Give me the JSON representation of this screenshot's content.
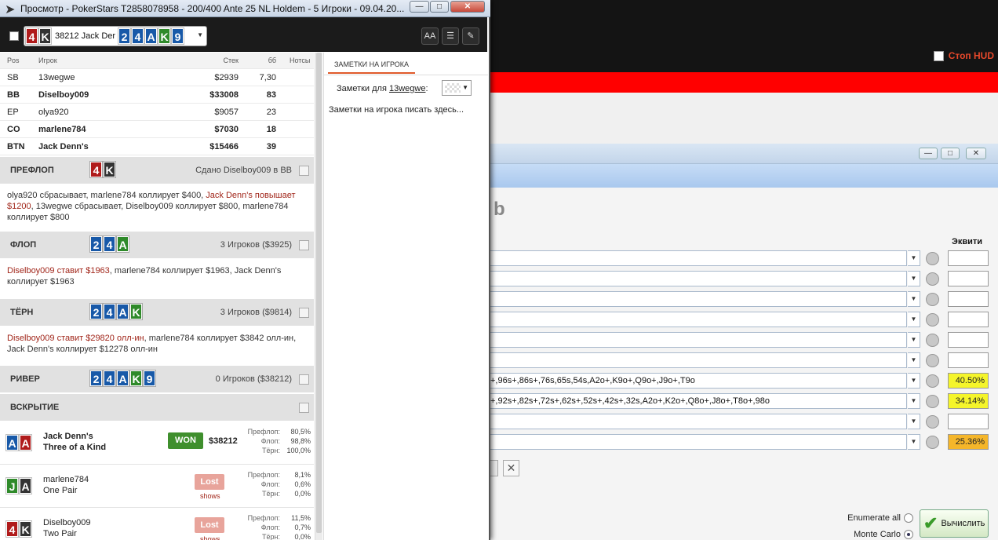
{
  "window": {
    "title": "Просмотр - PokerStars T2858078958 - 200/400 Ante 25 NL Holdem - 5 Игроки - 09.04.20...",
    "min_label": "—",
    "max_label": "□",
    "close_label": "✕"
  },
  "toolbar": {
    "hand_selector": {
      "hero_cards": [
        {
          "rank": "4",
          "color": "red"
        },
        {
          "rank": "K",
          "color": "blk"
        }
      ],
      "label": "38212 Jack Der",
      "board": [
        {
          "rank": "2",
          "color": "blue"
        },
        {
          "rank": "4",
          "color": "blue"
        },
        {
          "rank": "A",
          "color": "blue"
        },
        {
          "rank": "K",
          "color": "grn"
        },
        {
          "rank": "9",
          "color": "blue"
        }
      ]
    },
    "font_button": "AA",
    "list_button": "☰",
    "edit_button": "✎"
  },
  "players_table": {
    "headers": {
      "pos": "Pos",
      "player": "Игрок",
      "stack": "Стек",
      "bb": "бб",
      "notes": "Нотсы"
    },
    "rows": [
      {
        "pos": "SB",
        "name": "13wegwe",
        "stack": "$2939",
        "bb": "7,30",
        "bold": false
      },
      {
        "pos": "BB",
        "name": "Diselboy009",
        "stack": "$33008",
        "bb": "83",
        "bold": true
      },
      {
        "pos": "EP",
        "name": "olya920",
        "stack": "$9057",
        "bb": "23",
        "bold": false
      },
      {
        "pos": "CO",
        "name": "marlene784",
        "stack": "$7030",
        "bb": "18",
        "bold": true
      },
      {
        "pos": "BTN",
        "name": "Jack Denn's",
        "stack": "$15466",
        "bb": "39",
        "bold": true
      }
    ]
  },
  "streets": {
    "preflop": {
      "name": "ПРЕФЛОП",
      "cards": [
        {
          "rank": "4",
          "color": "red"
        },
        {
          "rank": "K",
          "color": "blk"
        }
      ],
      "info": "Сдано Diselboy009 в BB",
      "actions_a": "olya920 сбрасывает, marlene784 коллирует $400, ",
      "actions_b": "Jack Denn's повышает $1200",
      "actions_c": ", 13wegwe сбрасывает, Diselboy009 коллирует $800, marlene784 коллирует $800"
    },
    "flop": {
      "name": "ФЛОП",
      "cards": [
        {
          "rank": "2",
          "color": "blue"
        },
        {
          "rank": "4",
          "color": "blue"
        },
        {
          "rank": "A",
          "color": "grn"
        }
      ],
      "info": "3 Игроков ($3925)",
      "actions_a": "Diselboy009 ставит $1963",
      "actions_b": ", marlene784 коллирует $1963, Jack Denn's коллирует $1963"
    },
    "turn": {
      "name": "ТЁРН",
      "cards": [
        {
          "rank": "2",
          "color": "blue"
        },
        {
          "rank": "4",
          "color": "blue"
        },
        {
          "rank": "A",
          "color": "blue"
        },
        {
          "rank": "K",
          "color": "grn"
        }
      ],
      "info": "3 Игроков ($9814)",
      "actions_a": "Diselboy009 ставит $29820 олл-ин",
      "actions_b": ", marlene784 коллирует $3842 олл-ин, Jack Denn's коллирует $12278 олл-ин"
    },
    "river": {
      "name": "РИВЕР",
      "cards": [
        {
          "rank": "2",
          "color": "blue"
        },
        {
          "rank": "4",
          "color": "blue"
        },
        {
          "rank": "A",
          "color": "blue"
        },
        {
          "rank": "K",
          "color": "grn"
        },
        {
          "rank": "9",
          "color": "blue"
        }
      ],
      "info": "0 Игроков ($38212)"
    },
    "showdown": {
      "name": "ВСКРЫТИЕ"
    }
  },
  "results": [
    {
      "cards": [
        {
          "rank": "A",
          "color": "blue"
        },
        {
          "rank": "A",
          "color": "red"
        }
      ],
      "name": "Jack Denn's",
      "hand": "Three of a Kind",
      "bold": true,
      "status": "WON",
      "amount": "$38212",
      "eq_labels": [
        "Префлоп:",
        "Флоп:",
        "Тёрн:"
      ],
      "eq_values": [
        "80,5%",
        "98,8%",
        "100,0%"
      ]
    },
    {
      "cards": [
        {
          "rank": "J",
          "color": "grn"
        },
        {
          "rank": "A",
          "color": "blk"
        }
      ],
      "name": "marlene784",
      "hand": "One Pair",
      "bold": false,
      "status": "Lost",
      "shows": "shows",
      "eq_labels": [
        "Префлоп:",
        "Флоп:",
        "Тёрн:"
      ],
      "eq_values": [
        "8,1%",
        "0,6%",
        "0,0%"
      ]
    },
    {
      "cards": [
        {
          "rank": "4",
          "color": "red"
        },
        {
          "rank": "K",
          "color": "blk"
        }
      ],
      "name": "Diselboy009",
      "hand": "Two Pair",
      "bold": false,
      "status": "Lost",
      "shows": "shows",
      "eq_labels": [
        "Префлоп:",
        "Флоп:",
        "Тёрн:"
      ],
      "eq_values": [
        "11,5%",
        "0,7%",
        "0,0%"
      ]
    }
  ],
  "notes": {
    "tab_label": "ЗАМЕТКИ НА ИГРОКА",
    "for_label": "Заметки для ",
    "for_player": "13wegwe",
    "for_suffix": ":",
    "placeholder": "Заметки на игрока писать здесь..."
  },
  "background_app": {
    "stop_hud": "Стоп HUD",
    "equity": {
      "big_title_fragment": "b",
      "column_header": "Эквити",
      "rows": [
        {
          "range": "",
          "equity": ""
        },
        {
          "range": "",
          "equity": ""
        },
        {
          "range": "",
          "equity": ""
        },
        {
          "range": "",
          "equity": ""
        },
        {
          "range": "",
          "equity": ""
        },
        {
          "range": "",
          "equity": ""
        },
        {
          "range": "+,96s+,86s+,76s,65s,54s,A2o+,K9o+,Q9o+,J9o+,T9o",
          "equity": "40.50%",
          "highlight": "#f5f52a"
        },
        {
          "range": "+,92s+,82s+,72s+,62s+,52s+,42s+,32s,A2o+,K2o+,Q8o+,J8o+,T8o+,98o",
          "equity": "34.14%",
          "highlight": "#f5f52a"
        },
        {
          "range": "",
          "equity": ""
        },
        {
          "range": "",
          "equity": "25.36%",
          "highlight": "#f5b62a"
        }
      ],
      "enumerate_label": "Enumerate all",
      "montecarlo_label": "Monte Carlo",
      "calc_label": "Вычислить"
    }
  }
}
